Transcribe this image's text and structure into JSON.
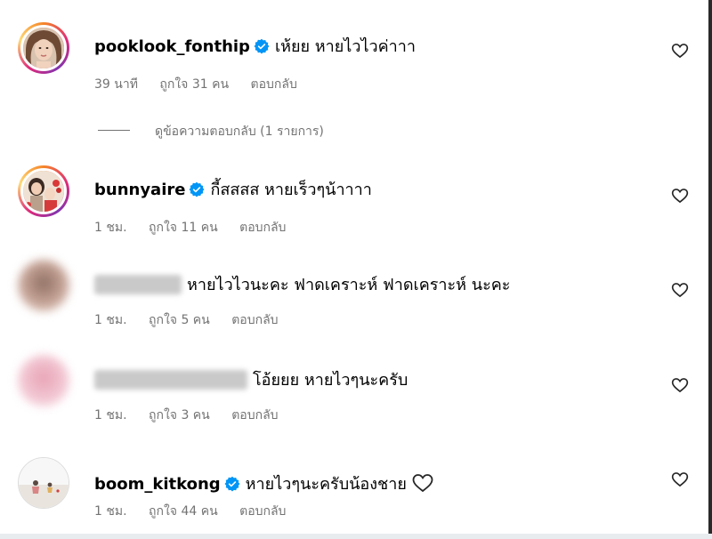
{
  "comments": [
    {
      "username": "pooklook_fonthip",
      "verified": true,
      "text": "เห้ยย หายไวไวค่าาา",
      "time": "39 นาที",
      "likes": "ถูกใจ 31 คน",
      "reply": "ตอบกลับ"
    },
    {
      "username": "bunnyaire",
      "verified": true,
      "text": "กี้สสสส หายเร็วๆน้าาาา",
      "time": "1 ชม.",
      "likes": "ถูกใจ 11 คน",
      "reply": "ตอบกลับ"
    },
    {
      "username": "",
      "verified": false,
      "text": "หายไวไวนะคะ ฟาดเคราะห์ ฟาดเคราะห์ นะคะ",
      "time": "1 ชม.",
      "likes": "ถูกใจ 5 คน",
      "reply": "ตอบกลับ"
    },
    {
      "username": "",
      "verified": false,
      "text": "โอ้ยยย หายไวๆนะครับ",
      "time": "1 ชม.",
      "likes": "ถูกใจ 3 คน",
      "reply": "ตอบกลับ"
    },
    {
      "username": "boom_kitkong",
      "verified": true,
      "text": "หายไวๆนะครับน้องชาย",
      "time": "1 ชม.",
      "likes": "ถูกใจ 44 คน",
      "reply": "ตอบกลับ"
    }
  ],
  "view_replies": "ดูข้อความตอบกลับ (1 รายการ)",
  "icons": {
    "like": "heart-outline-icon",
    "verified": "verified-badge-icon"
  },
  "colors": {
    "verified_blue": "#0095f6",
    "meta_gray": "#737373"
  }
}
